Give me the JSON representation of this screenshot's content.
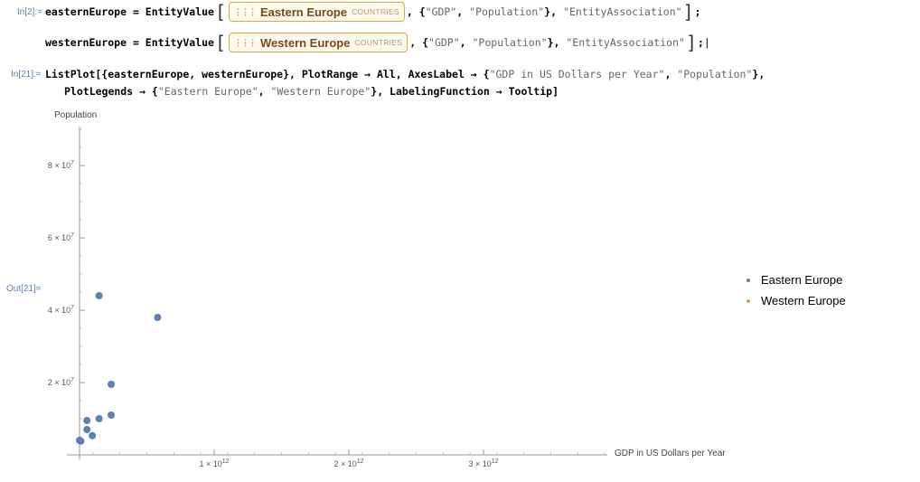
{
  "cells": {
    "in2_label": "In[2]:=",
    "line1": {
      "var": "easternEurope",
      "eq": " = ",
      "func": "EntityValue",
      "entity_icon": "⋮⋮⋮",
      "entity_name": "Eastern Europe",
      "entity_type": "COUNTRIES",
      "args_prefix": ", {",
      "arg1": "\"GDP\"",
      "sep": ", ",
      "arg2": "\"Population\"",
      "args_mid": "}, ",
      "arg3": "\"EntityAssociation\"",
      "end": ";"
    },
    "line2": {
      "var": "westernEurope",
      "eq": " = ",
      "func": "EntityValue",
      "entity_icon": "⋮⋮⋮",
      "entity_name": "Western Europe",
      "entity_type": "COUNTRIES",
      "args_prefix": ", {",
      "arg1": "\"GDP\"",
      "sep": ", ",
      "arg2": "\"Population\"",
      "args_mid": "}, ",
      "arg3": "\"EntityAssociation\"",
      "end": ";",
      "cursor": "|"
    },
    "in21_label": "In[21]:=",
    "line3": {
      "a": "ListPlot[{easternEurope, westernEurope}, PlotRange → All, AxesLabel → {",
      "s1": "\"GDP in US Dollars per Year\"",
      "b": ", ",
      "s2": "\"Population\"",
      "c": "},"
    },
    "line4": {
      "a": "PlotLegends → {",
      "s1": "\"Eastern Europe\"",
      "b": ", ",
      "s2": "\"Western Europe\"",
      "c": "}, LabelingFunction → Tooltip]"
    },
    "out21_label": "Out[21]="
  },
  "chart_data": {
    "type": "scatter",
    "xlabel": "GDP in US Dollars per Year",
    "ylabel": "Population",
    "xlim": [
      0,
      3900000000000
    ],
    "ylim": [
      0,
      90000000
    ],
    "x_ticks": [
      {
        "value": 1000000000000,
        "mant": "1",
        "exp": "12"
      },
      {
        "value": 2000000000000,
        "mant": "2",
        "exp": "12"
      },
      {
        "value": 3000000000000,
        "mant": "3",
        "exp": "12"
      }
    ],
    "y_ticks": [
      {
        "value": 20000000,
        "mant": "2",
        "exp": "7"
      },
      {
        "value": 40000000,
        "mant": "4",
        "exp": "7"
      },
      {
        "value": 60000000,
        "mant": "6",
        "exp": "7"
      },
      {
        "value": 80000000,
        "mant": "8",
        "exp": "7"
      }
    ],
    "times_sign": "×",
    "mant_suffix": " × 10",
    "legend_position": "right",
    "series": [
      {
        "name": "Eastern Europe",
        "color": "#5e81b5",
        "points": [
          [
            0,
            4000000
          ],
          [
            10000000000,
            3800000
          ],
          [
            55000000000,
            9500000
          ],
          [
            55000000000,
            7000000
          ],
          [
            95000000000,
            5300000
          ],
          [
            145000000000,
            10000000
          ],
          [
            145000000000,
            44000000
          ],
          [
            235000000000,
            11000000
          ],
          [
            235000000000,
            19500000
          ],
          [
            580000000000,
            38000000
          ]
        ]
      },
      {
        "name": "Western Europe",
        "color": "#e19c24",
        "points": []
      }
    ]
  }
}
